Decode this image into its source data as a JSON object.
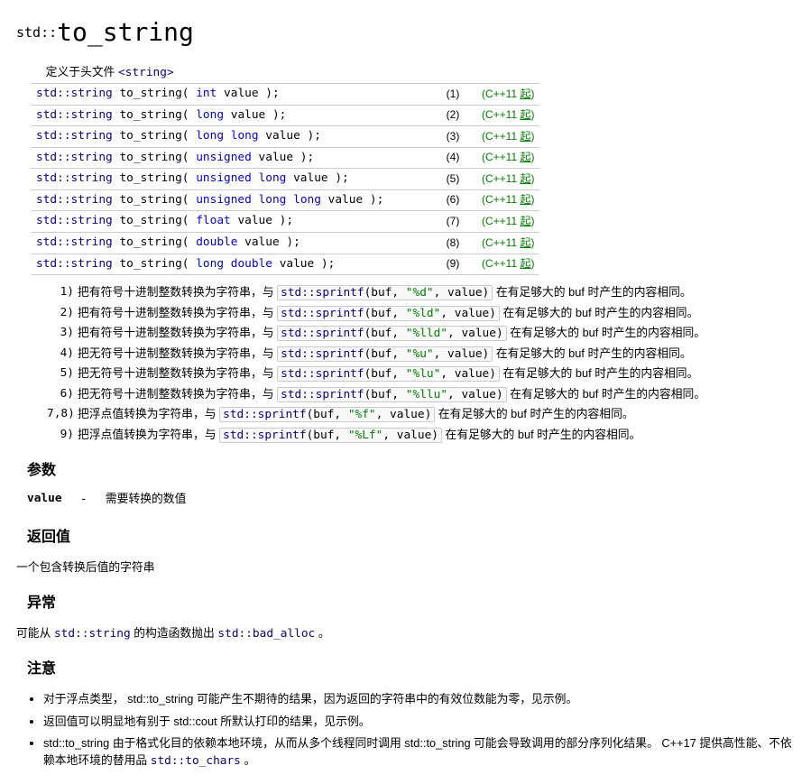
{
  "title_ns": "std::",
  "title_name": "to_string",
  "header_label": "定义于头文件 ",
  "header_value": "<string>",
  "decl": [
    {
      "pre": "std::string",
      "fn": "to_string",
      "args": "( int value );",
      "num": "(1)",
      "since": "(C++11 起)"
    },
    {
      "pre": "std::string",
      "fn": "to_string",
      "args": "( long value );",
      "num": "(2)",
      "since": "(C++11 起)"
    },
    {
      "pre": "std::string",
      "fn": "to_string",
      "args": "( long long value );",
      "num": "(3)",
      "since": "(C++11 起)"
    },
    {
      "pre": "std::string",
      "fn": "to_string",
      "args": "( unsigned value );",
      "num": "(4)",
      "since": "(C++11 起)"
    },
    {
      "pre": "std::string",
      "fn": "to_string",
      "args": "( unsigned long value );",
      "num": "(5)",
      "since": "(C++11 起)"
    },
    {
      "pre": "std::string",
      "fn": "to_string",
      "args": "( unsigned long long value );",
      "num": "(6)",
      "since": "(C++11 起)"
    },
    {
      "pre": "std::string",
      "fn": "to_string",
      "args": "( float value );",
      "num": "(7)",
      "since": "(C++11 起)"
    },
    {
      "pre": "std::string",
      "fn": "to_string",
      "args": "( double value );",
      "num": "(8)",
      "since": "(C++11 起)"
    },
    {
      "pre": "std::string",
      "fn": "to_string",
      "args": "( long double value );",
      "num": "(9)",
      "since": "(C++11 起)"
    }
  ],
  "desc": [
    {
      "idx": "1)",
      "before": "把有符号十进制整数转换为字符串，与 ",
      "fn": "std::sprintf",
      "call": "(buf, ",
      "fmt": "\"%d\"",
      "tail": ", value)",
      "after": " 在有足够大的 buf 时产生的内容相同。"
    },
    {
      "idx": "2)",
      "before": "把有符号十进制整数转换为字符串，与 ",
      "fn": "std::sprintf",
      "call": "(buf, ",
      "fmt": "\"%ld\"",
      "tail": ", value)",
      "after": " 在有足够大的 buf 时产生的内容相同。"
    },
    {
      "idx": "3)",
      "before": "把有符号十进制整数转换为字符串，与 ",
      "fn": "std::sprintf",
      "call": "(buf, ",
      "fmt": "\"%lld\"",
      "tail": ", value)",
      "after": " 在有足够大的 buf 时产生的内容相同。"
    },
    {
      "idx": "4)",
      "before": "把无符号十进制整数转换为字符串，与 ",
      "fn": "std::sprintf",
      "call": "(buf, ",
      "fmt": "\"%u\"",
      "tail": ", value)",
      "after": " 在有足够大的 buf 时产生的内容相同。"
    },
    {
      "idx": "5)",
      "before": "把无符号十进制整数转换为字符串，与 ",
      "fn": "std::sprintf",
      "call": "(buf, ",
      "fmt": "\"%lu\"",
      "tail": ", value)",
      "after": " 在有足够大的 buf 时产生的内容相同。"
    },
    {
      "idx": "6)",
      "before": "把无符号十进制整数转换为字符串，与 ",
      "fn": "std::sprintf",
      "call": "(buf, ",
      "fmt": "\"%llu\"",
      "tail": ", value)",
      "after": " 在有足够大的 buf 时产生的内容相同。"
    },
    {
      "idx": "7,8)",
      "before": "把浮点值转换为字符串，与 ",
      "fn": "std::sprintf",
      "call": "(buf, ",
      "fmt": "\"%f\"",
      "tail": ", value)",
      "after": " 在有足够大的 buf 时产生的内容相同。"
    },
    {
      "idx": "9)",
      "before": "把浮点值转换为字符串，与 ",
      "fn": "std::sprintf",
      "call": "(buf, ",
      "fmt": "\"%Lf\"",
      "tail": ", value)",
      "after": " 在有足够大的 buf 时产生的内容相同。"
    }
  ],
  "sections": {
    "params_h": "参数",
    "param_name": "value",
    "param_sep": "-",
    "param_desc": "需要转换的数值",
    "return_h": "返回值",
    "return_text": "一个包含转换后值的字符串",
    "except_h": "异常",
    "except_before": "可能从 ",
    "except_link1": "std::string",
    "except_mid": " 的构造函数抛出 ",
    "except_link2": "std::bad_alloc",
    "except_after": " 。",
    "notes_h": "注意"
  },
  "notes": [
    {
      "text": "对于浮点类型， std::to_string 可能产生不期待的结果，因为返回的字符串中的有效位数能为零，见示例。"
    },
    {
      "text": "返回值可以明显地有别于 std::cout 所默认打印的结果，见示例。"
    },
    {
      "before": "std::to_string 由于格式化目的依赖本地环境，从而从多个线程同时调用 std::to_string 可能会导致调用的部分序列化结果。 C++17 提供高性能、不依赖本地环境的替用品 ",
      "link": "std::to_chars",
      "after": " 。"
    }
  ]
}
